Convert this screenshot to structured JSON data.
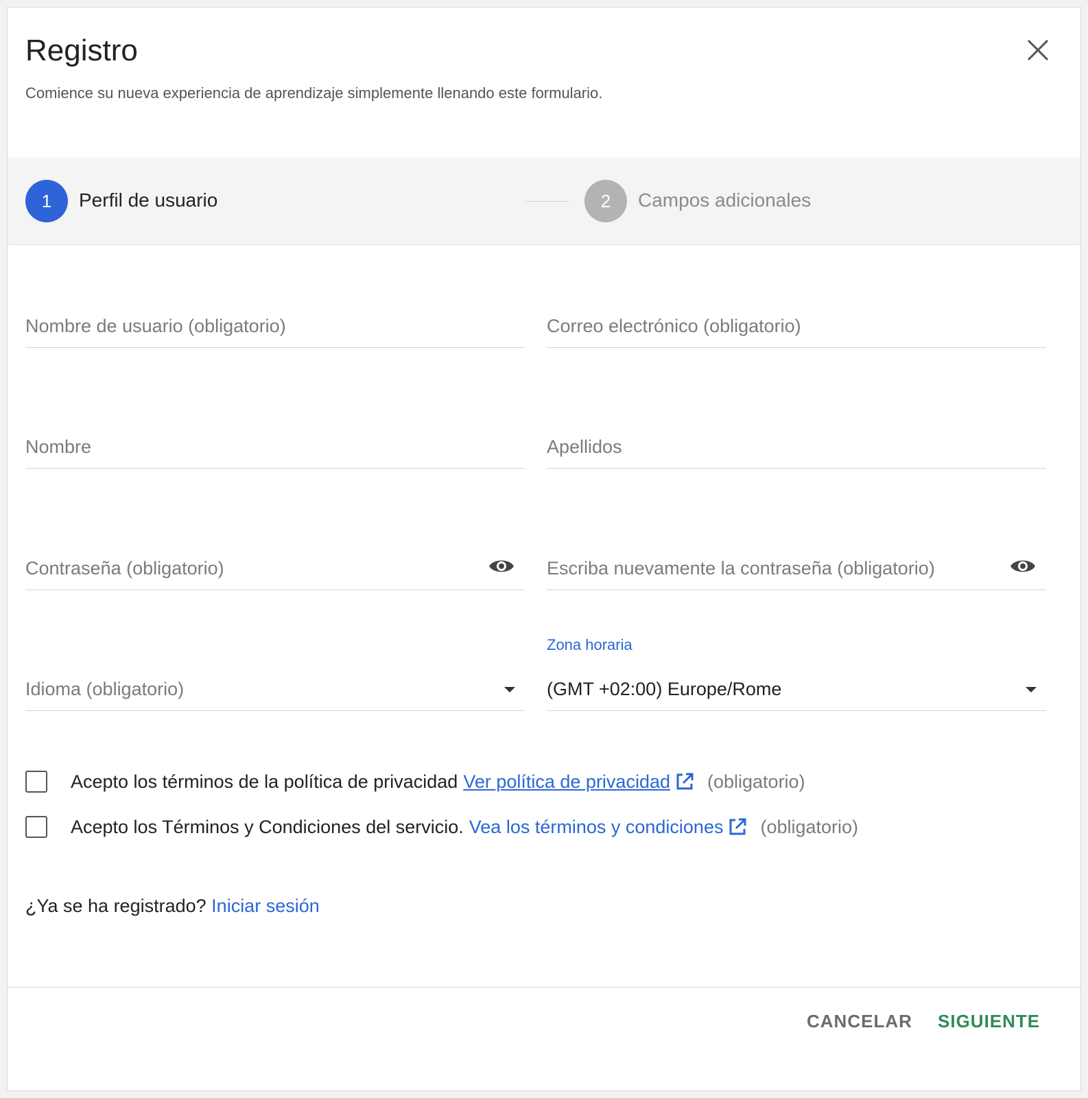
{
  "dialog": {
    "title": "Registro",
    "subtitle": "Comience su nueva experiencia de aprendizaje simplemente llenando este formulario."
  },
  "stepper": {
    "steps": [
      {
        "number": "1",
        "label": "Perfil de usuario",
        "active": true
      },
      {
        "number": "2",
        "label": "Campos adicionales",
        "active": false
      }
    ]
  },
  "form": {
    "username": {
      "label": "Nombre de usuario  (obligatorio)"
    },
    "email": {
      "label": "Correo electrónico  (obligatorio)"
    },
    "first_name": {
      "label": "Nombre"
    },
    "last_name": {
      "label": "Apellidos"
    },
    "password": {
      "label": "Contraseña (obligatorio)"
    },
    "password_confirm": {
      "label": "Escriba nuevamente la contraseña (obligatorio)"
    },
    "language": {
      "label": "Idioma (obligatorio)"
    },
    "timezone": {
      "label": "Zona horaria",
      "value": "(GMT +02:00) Europe/Rome"
    }
  },
  "consents": {
    "privacy": {
      "text": "Acepto los términos de la política de privacidad",
      "link": "Ver política de privacidad",
      "required": "(obligatorio)"
    },
    "terms": {
      "text": "Acepto los Términos y Condiciones del servicio.",
      "link": "Vea los términos y condiciones",
      "required": "(obligatorio)"
    }
  },
  "login": {
    "prompt": "¿Ya se ha registrado?",
    "link": "Iniciar sesión"
  },
  "footer": {
    "cancel": "CANCELAR",
    "next": "SIGUIENTE"
  },
  "icons": {
    "close": "close-icon",
    "eye": "eye-icon",
    "external": "external-link-icon",
    "caret": "caret-down-icon"
  },
  "colors": {
    "primary": "#2f63d8",
    "link": "#2b67d6",
    "next": "#2e8b57",
    "inactive_step": "#b3b3b3"
  }
}
